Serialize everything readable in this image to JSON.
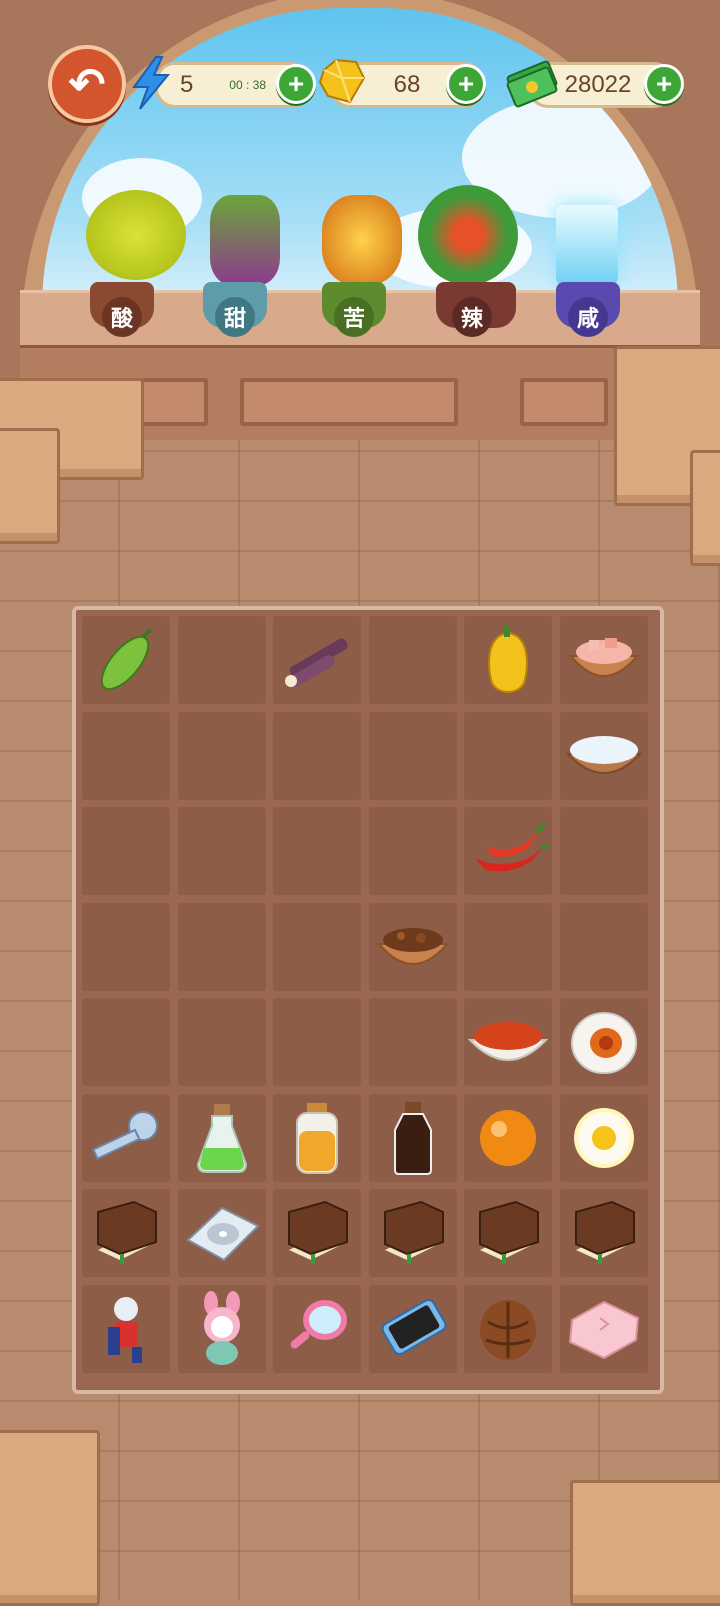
{
  "top_bar": {
    "energy": {
      "value": "5",
      "timer": "00 : 38",
      "icon": "lightning-icon"
    },
    "gems": {
      "value": "68",
      "icon": "gem-icon"
    },
    "cash": {
      "value": "28022",
      "icon": "cash-icon"
    },
    "plus_symbol": "+"
  },
  "flavor_plants": [
    {
      "label": "酸",
      "name": "sour",
      "color": "#f2c21b"
    },
    {
      "label": "甜",
      "name": "sweet",
      "color": "#9a3f9e"
    },
    {
      "label": "苦",
      "name": "bitter",
      "color": "#e58a1a"
    },
    {
      "label": "辣",
      "name": "spicy",
      "color": "#e2492a"
    },
    {
      "label": "咸",
      "name": "salty",
      "color": "#8ad8f5"
    }
  ],
  "board": {
    "cols": 6,
    "rows": 8,
    "items": [
      {
        "row": 0,
        "col": 0,
        "name": "bitter-melon-icon"
      },
      {
        "row": 0,
        "col": 2,
        "name": "sugarcane-icon"
      },
      {
        "row": 0,
        "col": 4,
        "name": "yellow-pepper-icon"
      },
      {
        "row": 0,
        "col": 5,
        "name": "rock-salt-bowl-icon"
      },
      {
        "row": 1,
        "col": 5,
        "name": "salt-bowl-icon"
      },
      {
        "row": 2,
        "col": 4,
        "name": "red-chili-icon"
      },
      {
        "row": 3,
        "col": 3,
        "name": "spice-bowl-icon"
      },
      {
        "row": 4,
        "col": 4,
        "name": "chili-powder-bowl-icon"
      },
      {
        "row": 4,
        "col": 5,
        "name": "salted-egg-icon"
      },
      {
        "row": 5,
        "col": 0,
        "name": "key-icon"
      },
      {
        "row": 5,
        "col": 1,
        "name": "green-potion-icon"
      },
      {
        "row": 5,
        "col": 2,
        "name": "honey-jar-icon"
      },
      {
        "row": 5,
        "col": 3,
        "name": "soy-sauce-bottle-icon"
      },
      {
        "row": 5,
        "col": 4,
        "name": "orange-orb-icon"
      },
      {
        "row": 5,
        "col": 5,
        "name": "fried-egg-icon"
      },
      {
        "row": 6,
        "col": 0,
        "name": "book-icon"
      },
      {
        "row": 6,
        "col": 1,
        "name": "cd-case-icon"
      },
      {
        "row": 6,
        "col": 2,
        "name": "book-icon"
      },
      {
        "row": 6,
        "col": 3,
        "name": "book-icon"
      },
      {
        "row": 6,
        "col": 4,
        "name": "book-icon"
      },
      {
        "row": 6,
        "col": 5,
        "name": "book-icon"
      },
      {
        "row": 7,
        "col": 0,
        "name": "hero-figure-icon"
      },
      {
        "row": 7,
        "col": 1,
        "name": "bunny-plush-icon"
      },
      {
        "row": 7,
        "col": 2,
        "name": "hand-mirror-icon"
      },
      {
        "row": 7,
        "col": 3,
        "name": "smartphone-icon"
      },
      {
        "row": 7,
        "col": 4,
        "name": "walnut-icon"
      },
      {
        "row": 7,
        "col": 5,
        "name": "pink-pillow-icon"
      }
    ]
  }
}
